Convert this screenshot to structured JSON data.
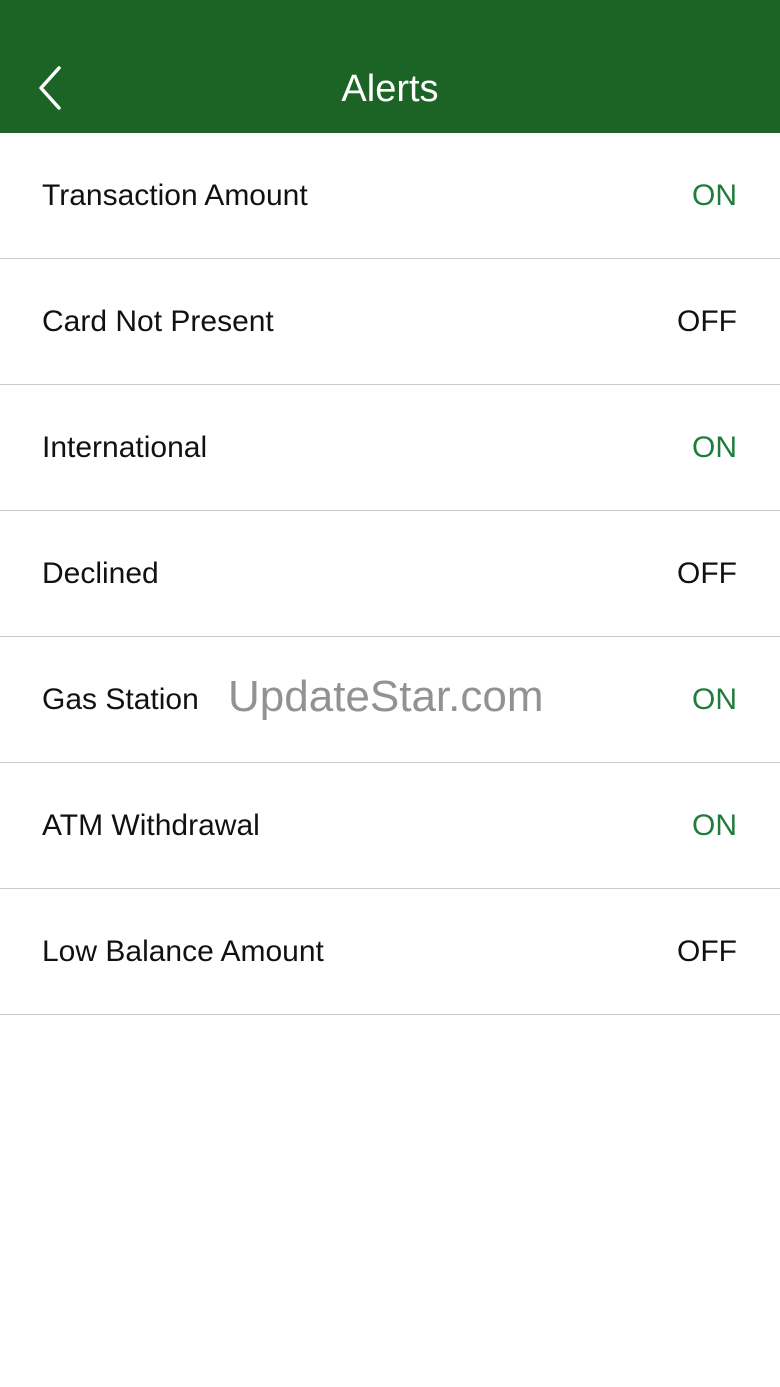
{
  "header": {
    "title": "Alerts",
    "back_icon": "chevron-left-icon",
    "background_color": "#1b6426"
  },
  "alerts": [
    {
      "label": "Transaction Amount",
      "state": "ON"
    },
    {
      "label": "Card Not Present",
      "state": "OFF"
    },
    {
      "label": "International",
      "state": "ON"
    },
    {
      "label": "Declined",
      "state": "OFF"
    },
    {
      "label": "Gas Station",
      "state": "ON"
    },
    {
      "label": "ATM Withdrawal",
      "state": "ON"
    },
    {
      "label": "Low Balance Amount",
      "state": "OFF"
    }
  ],
  "colors": {
    "on": "#1f7d3c",
    "off": "#111111"
  },
  "watermark": "UpdateStar.com"
}
